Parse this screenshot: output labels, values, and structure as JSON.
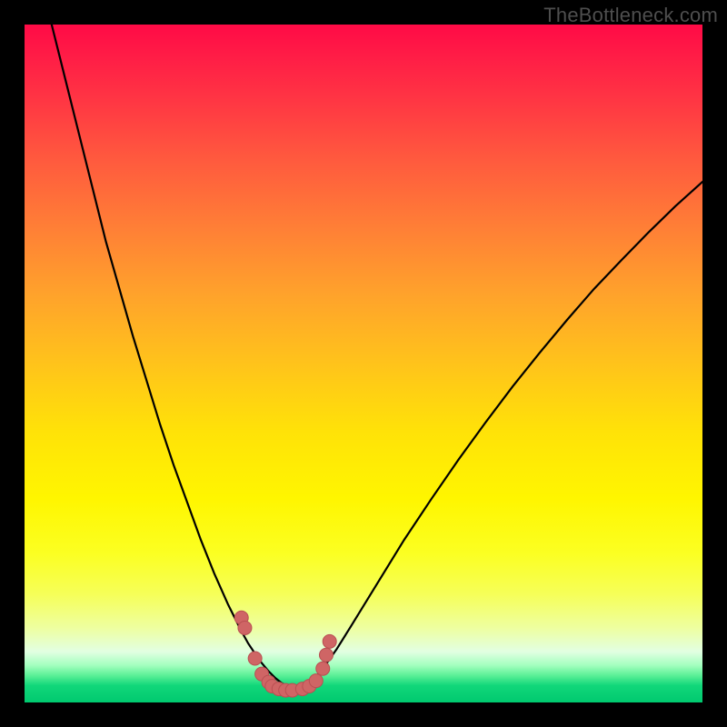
{
  "watermark": "TheBottleneck.com",
  "colors": {
    "frame": "#000000",
    "curve_stroke": "#000000",
    "marker_fill": "#cf6565",
    "marker_stroke": "#b94f52",
    "gradient_top": "#ff0a46",
    "gradient_bottom": "#00c96f"
  },
  "chart_data": {
    "type": "line",
    "title": "",
    "xlabel": "",
    "ylabel": "",
    "xlim": [
      0,
      100
    ],
    "ylim": [
      0,
      100
    ],
    "grid": false,
    "note": "Axes are unlabeled in the source image; x/y are normalized 0-100 left→right and bottom→top. Two black V-shaped curves meet near the bottom; salmon markers cluster near the valley.",
    "series": [
      {
        "name": "left-curve",
        "x": [
          4,
          6,
          8,
          10,
          12,
          14,
          16,
          18,
          20,
          22,
          24,
          26,
          28,
          30,
          32,
          33,
          34,
          35,
          36,
          37,
          38,
          39,
          40
        ],
        "y": [
          100,
          92,
          84,
          76,
          68,
          61,
          54,
          47.5,
          41,
          35,
          29.5,
          24,
          19,
          14.5,
          10.5,
          8.7,
          7.2,
          5.8,
          4.6,
          3.6,
          2.8,
          2.3,
          2.0
        ]
      },
      {
        "name": "right-curve",
        "x": [
          40,
          41,
          42,
          43,
          44,
          46,
          48,
          52,
          56,
          60,
          64,
          68,
          72,
          76,
          80,
          84,
          88,
          92,
          96,
          100
        ],
        "y": [
          2.0,
          2.3,
          2.9,
          3.8,
          5.0,
          7.8,
          11.0,
          17.5,
          24.0,
          30.0,
          35.8,
          41.3,
          46.6,
          51.6,
          56.4,
          61.0,
          65.2,
          69.3,
          73.2,
          76.8
        ]
      },
      {
        "name": "valley-markers",
        "style": "points",
        "x": [
          32.0,
          32.5,
          34.0,
          35.0,
          36.0,
          36.5,
          37.5,
          38.5,
          39.5,
          41.0,
          42.0,
          43.0,
          44.0,
          44.5,
          45.0
        ],
        "y": [
          12.5,
          11.0,
          6.5,
          4.2,
          3.0,
          2.4,
          2.0,
          1.8,
          1.8,
          2.0,
          2.4,
          3.2,
          5.0,
          7.0,
          9.0
        ]
      }
    ]
  }
}
